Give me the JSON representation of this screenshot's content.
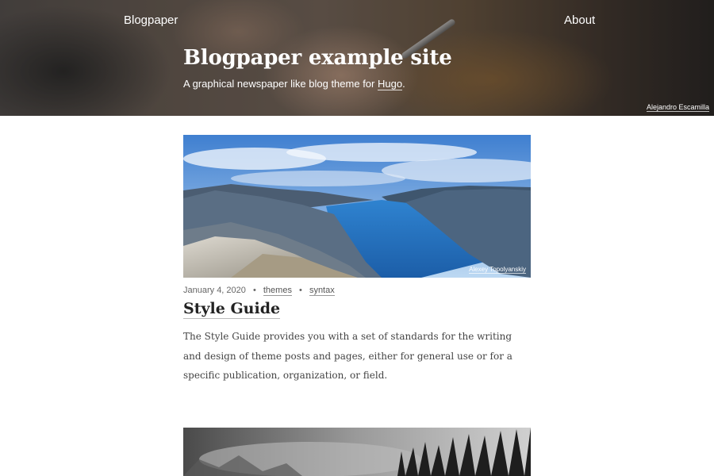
{
  "header": {
    "brand": "Blogpaper",
    "nav_about": "About",
    "site_title": "Blogpaper example site",
    "tagline_prefix": "A graphical newspaper like blog theme for ",
    "tagline_link": "Hugo",
    "tagline_suffix": ".",
    "image_credit": "Alejandro Escamilla"
  },
  "posts": [
    {
      "image_credit": "Alexey Topolyanskiy",
      "date": "January 4, 2020",
      "tags": [
        "themes",
        "syntax"
      ],
      "title": "Style Guide",
      "summary": "The Style Guide provides you with a set of standards for the writing and design of theme posts and pages, either for general use or for a specific publication, organization, or field."
    }
  ],
  "colors": {
    "background": "#ffffff",
    "text": "#222222",
    "meta": "#666666"
  }
}
